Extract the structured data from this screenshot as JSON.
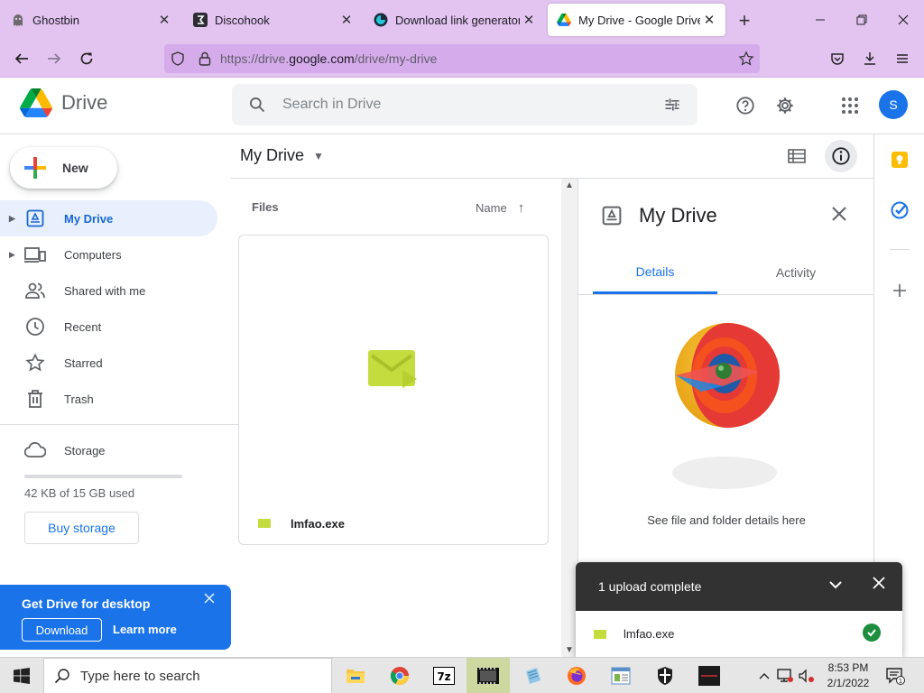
{
  "browser": {
    "tabs": [
      {
        "title": "Ghostbin",
        "icon": "ghost-icon"
      },
      {
        "title": "Discohook",
        "icon": "discohook-icon"
      },
      {
        "title": "Download link generator",
        "icon": "link-generator-icon"
      },
      {
        "title": "My Drive - Google Drive",
        "icon": "google-drive-icon",
        "active": true
      }
    ],
    "close_glyph": "✕",
    "new_tab_glyph": "+",
    "url_prefix": "https://drive.",
    "url_host": "google.com",
    "url_path": "/drive/my-drive",
    "window_controls": {
      "minimize": "—",
      "restore": "❐",
      "close": "✕"
    }
  },
  "drive": {
    "logo_text": "Drive",
    "search_placeholder": "Search in Drive",
    "avatar_letter": "S",
    "new_label": "New",
    "nav": [
      {
        "label": "My Drive",
        "icon": "my-drive-icon",
        "active": true,
        "expandable": true
      },
      {
        "label": "Computers",
        "icon": "computers-icon",
        "expandable": true
      },
      {
        "label": "Shared with me",
        "icon": "shared-icon"
      },
      {
        "label": "Recent",
        "icon": "clock-icon"
      },
      {
        "label": "Starred",
        "icon": "star-icon"
      },
      {
        "label": "Trash",
        "icon": "trash-icon"
      }
    ],
    "storage": {
      "label": "Storage",
      "used_text": "42 KB of 15 GB used",
      "used_fraction": 3e-06,
      "buy_label": "Buy storage"
    },
    "promo": {
      "title": "Get Drive for desktop",
      "download_label": "Download",
      "learn_more_label": "Learn more"
    },
    "main": {
      "breadcrumb": "My Drive",
      "files_header": "Files",
      "sort_header": "Name",
      "sort_arrow": "↑",
      "files": [
        {
          "name": "lmfao.exe",
          "icon": "exe-file-icon"
        }
      ]
    },
    "details": {
      "title": "My Drive",
      "tabs": [
        "Details",
        "Activity"
      ],
      "active_tab": "Details",
      "hint": "See file and folder details here"
    },
    "upload": {
      "title": "1 upload complete",
      "items": [
        {
          "name": "lmfao.exe",
          "status": "complete"
        }
      ]
    }
  },
  "taskbar": {
    "search_placeholder": "Type here to search",
    "time": "8:53 PM",
    "date": "2/1/2022",
    "notification_count": "1",
    "apps": [
      "file-explorer-icon",
      "chrome-icon",
      "7zip-icon",
      "media-app-icon",
      "notepad-icon",
      "firefox-icon",
      "registry-icon",
      "security-shield-icon",
      "terminal-app-icon"
    ]
  },
  "colors": {
    "chrome_tint": "#e3c4f1",
    "url_bar": "#d6abeb",
    "accent": "#1a73e8",
    "active_nav_bg": "#e8f0fe",
    "toast_bg": "#323232",
    "success": "#1e8e3e"
  }
}
